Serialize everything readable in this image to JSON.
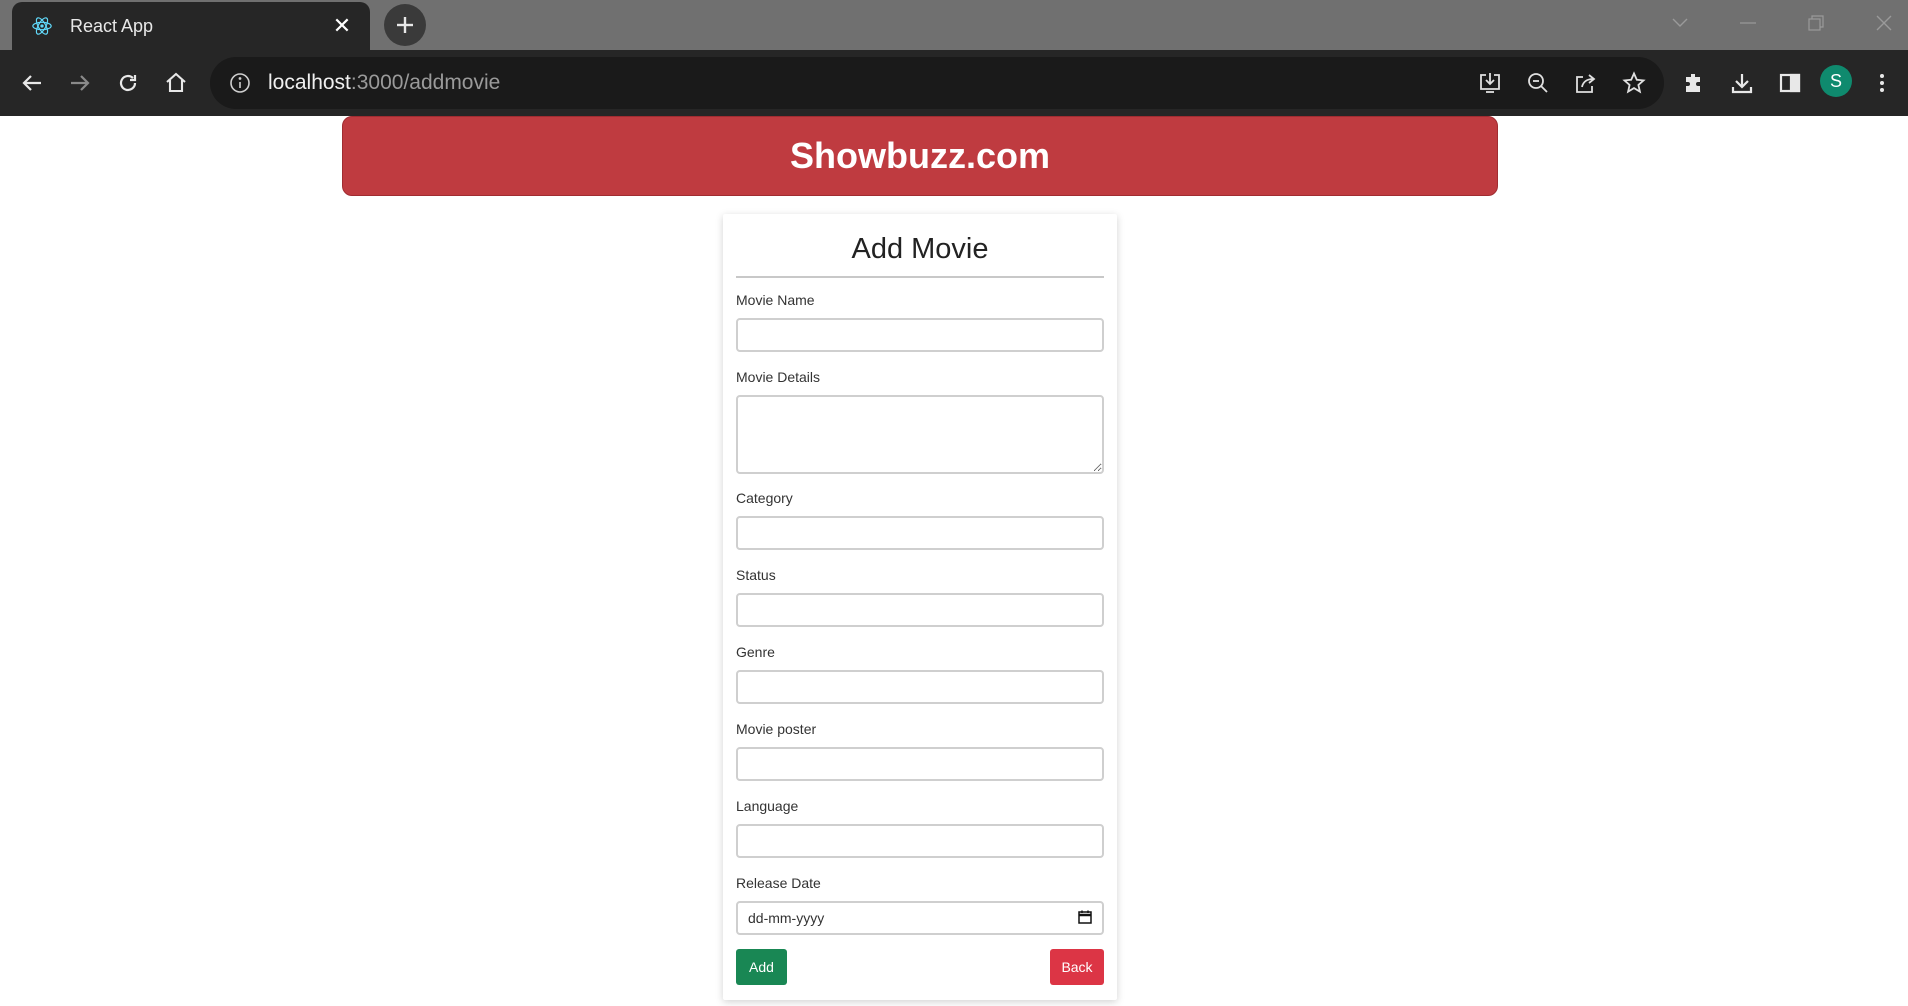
{
  "browser": {
    "tab_title": "React App",
    "url_host": "localhost",
    "url_path": ":3000/addmovie",
    "profile_initial": "S"
  },
  "icons": {
    "tab": [
      "react-logo-icon",
      "close-icon",
      "plus-icon"
    ],
    "nav": [
      "back-arrow-icon",
      "forward-arrow-icon",
      "reload-icon",
      "home-icon",
      "info-icon"
    ],
    "omnibox": [
      "install-icon",
      "zoom-out-icon",
      "share-icon",
      "star-icon"
    ],
    "toolbar": [
      "extensions-icon",
      "download-icon",
      "side-panel-icon",
      "menu-icon"
    ]
  },
  "colors": {
    "banner": "#bf3b40",
    "add_button": "#198754",
    "back_button": "#dc3545",
    "avatar": "#0f8a6e"
  },
  "page": {
    "site_title": "Showbuzz.com",
    "form_title": "Add Movie",
    "fields": {
      "movie_name": {
        "label": "Movie Name",
        "value": ""
      },
      "movie_details": {
        "label": "Movie Details",
        "value": ""
      },
      "category": {
        "label": "Category",
        "value": ""
      },
      "status": {
        "label": "Status",
        "value": ""
      },
      "genre": {
        "label": "Genre",
        "value": ""
      },
      "movie_poster": {
        "label": "Movie poster",
        "value": ""
      },
      "language": {
        "label": "Language",
        "value": ""
      },
      "release_date": {
        "label": "Release Date",
        "placeholder": "dd-mm-yyyy"
      }
    },
    "add_label": "Add",
    "back_label": "Back"
  }
}
